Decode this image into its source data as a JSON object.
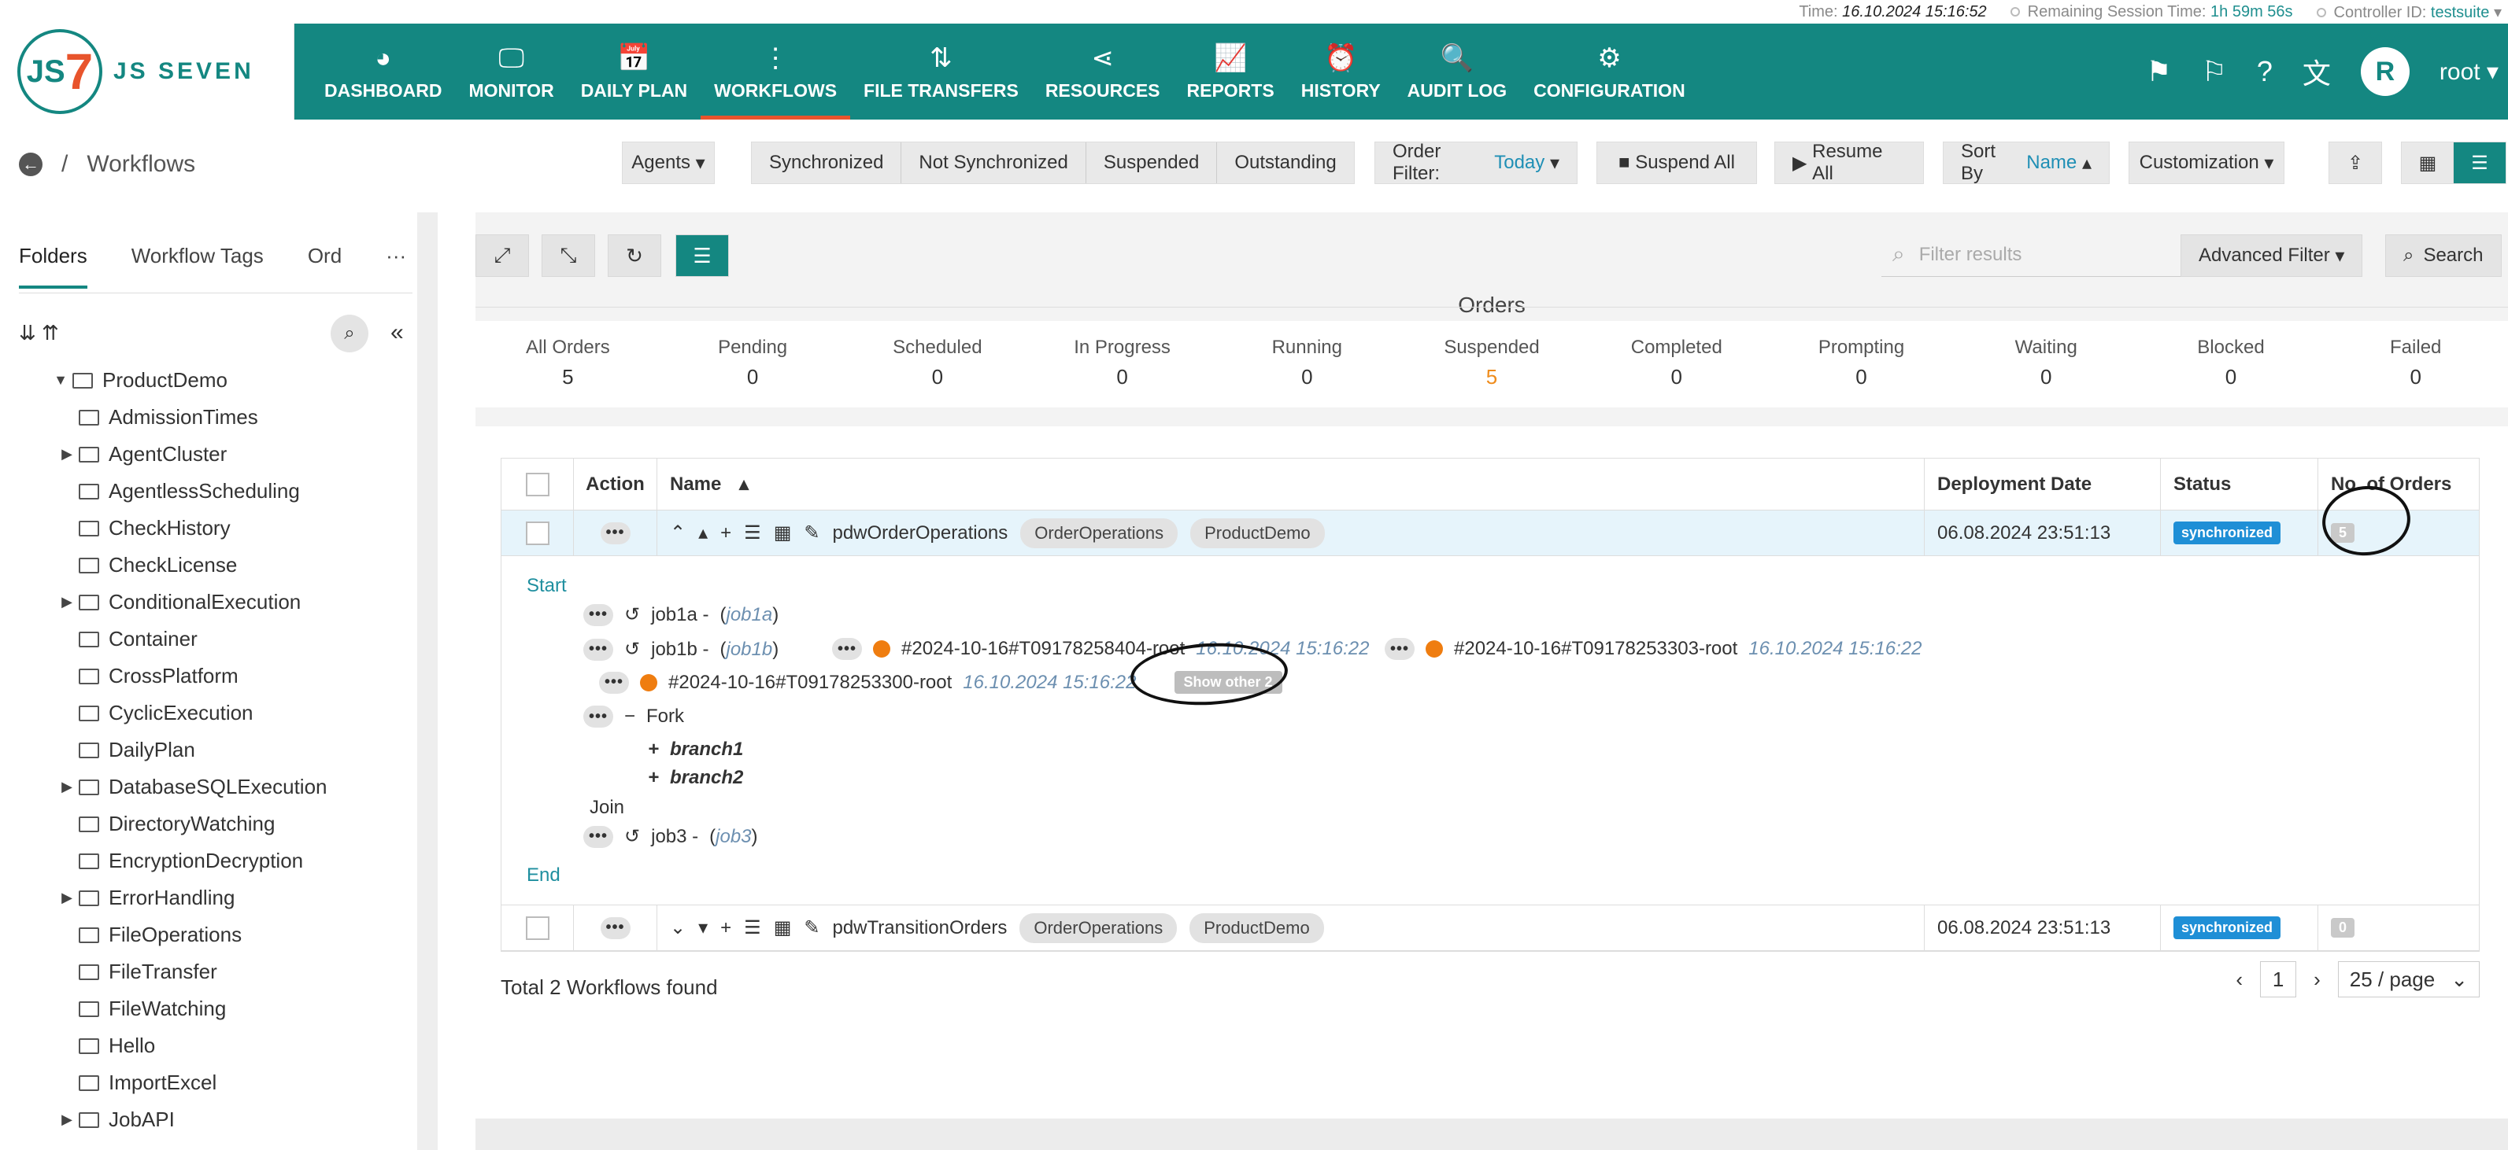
{
  "session": {
    "time_label": "Time:",
    "time_value": "16.10.2024 15:16:52",
    "remaining_label": "Remaining Session Time:",
    "remaining_value": "1h 59m 56s",
    "controller_label": "Controller ID:",
    "controller_value": "testsuite"
  },
  "brand": {
    "logo_mark": "JS7",
    "logo_text": "JS SEVEN"
  },
  "nav": [
    {
      "label": "DASHBOARD",
      "icon": "dashboard-icon",
      "glyph": "◕"
    },
    {
      "label": "MONITOR",
      "icon": "monitor-icon",
      "glyph": "🖵"
    },
    {
      "label": "DAILY PLAN",
      "icon": "calendar-icon",
      "glyph": "📅"
    },
    {
      "label": "WORKFLOWS",
      "icon": "workflow-icon",
      "glyph": "⋮",
      "active": true
    },
    {
      "label": "FILE TRANSFERS",
      "icon": "transfer-icon",
      "glyph": "⇅"
    },
    {
      "label": "RESOURCES",
      "icon": "share-icon",
      "glyph": "⋖"
    },
    {
      "label": "REPORTS",
      "icon": "chart-icon",
      "glyph": "📈"
    },
    {
      "label": "HISTORY",
      "icon": "clock-icon",
      "glyph": "⏰"
    },
    {
      "label": "AUDIT LOG",
      "icon": "audit-icon",
      "glyph": "🔍"
    },
    {
      "label": "CONFIGURATION",
      "icon": "gear-icon",
      "glyph": "⚙"
    }
  ],
  "user": {
    "avatar_letter": "R",
    "name": "root"
  },
  "breadcrumb": {
    "title": "Workflows"
  },
  "toolbar": {
    "agents": "Agents",
    "seg": [
      "Synchronized",
      "Not Synchronized",
      "Suspended",
      "Outstanding"
    ],
    "order_filter_label": "Order Filter:",
    "order_filter_value": "Today",
    "suspend_all": "Suspend All",
    "resume_all": "Resume All",
    "sort_label": "Sort By",
    "sort_value": "Name",
    "customization": "Customization"
  },
  "left": {
    "tabs": [
      "Folders",
      "Workflow Tags",
      "Ord"
    ],
    "more": "···",
    "root_folder": "ProductDemo",
    "folders": [
      {
        "name": "AdmissionTimes",
        "caret": false
      },
      {
        "name": "AgentCluster",
        "caret": true
      },
      {
        "name": "AgentlessScheduling",
        "caret": false
      },
      {
        "name": "CheckHistory",
        "caret": false
      },
      {
        "name": "CheckLicense",
        "caret": false
      },
      {
        "name": "ConditionalExecution",
        "caret": true
      },
      {
        "name": "Container",
        "caret": false
      },
      {
        "name": "CrossPlatform",
        "caret": false
      },
      {
        "name": "CyclicExecution",
        "caret": false
      },
      {
        "name": "DailyPlan",
        "caret": false
      },
      {
        "name": "DatabaseSQLExecution",
        "caret": true
      },
      {
        "name": "DirectoryWatching",
        "caret": false
      },
      {
        "name": "EncryptionDecryption",
        "caret": false
      },
      {
        "name": "ErrorHandling",
        "caret": true
      },
      {
        "name": "FileOperations",
        "caret": false
      },
      {
        "name": "FileTransfer",
        "caret": false
      },
      {
        "name": "FileWatching",
        "caret": false
      },
      {
        "name": "Hello",
        "caret": false
      },
      {
        "name": "ImportExcel",
        "caret": false
      },
      {
        "name": "JobAPI",
        "caret": true
      }
    ]
  },
  "main": {
    "filter_placeholder": "Filter results",
    "advanced_filter": "Advanced Filter",
    "search": "Search",
    "orders_title": "Orders",
    "stats": [
      {
        "label": "All Orders",
        "value": "5"
      },
      {
        "label": "Pending",
        "value": "0"
      },
      {
        "label": "Scheduled",
        "value": "0"
      },
      {
        "label": "In Progress",
        "value": "0"
      },
      {
        "label": "Running",
        "value": "0"
      },
      {
        "label": "Suspended",
        "value": "5",
        "orange": true
      },
      {
        "label": "Completed",
        "value": "0"
      },
      {
        "label": "Prompting",
        "value": "0"
      },
      {
        "label": "Waiting",
        "value": "0"
      },
      {
        "label": "Blocked",
        "value": "0"
      },
      {
        "label": "Failed",
        "value": "0"
      }
    ],
    "columns": {
      "action": "Action",
      "name": "Name",
      "date": "Deployment Date",
      "status": "Status",
      "orders": "No. of Orders"
    },
    "workflows": [
      {
        "name": "pdwOrderOperations",
        "tags": [
          "OrderOperations",
          "ProductDemo"
        ],
        "date": "06.08.2024 23:51:13",
        "status": "synchronized",
        "orders": "5"
      },
      {
        "name": "pdwTransitionOrders",
        "tags": [
          "OrderOperations",
          "ProductDemo"
        ],
        "date": "06.08.2024 23:51:13",
        "status": "synchronized",
        "orders": "0"
      }
    ],
    "expand": {
      "start": "Start",
      "end": "End",
      "job1a": "job1a -",
      "job1a_link": "job1a",
      "job1b": "job1b -",
      "job1b_link": "job1b",
      "order1": "#2024-10-16#T09178258404-root",
      "order1_time": "16.10.2024 15:16:22",
      "order2": "#2024-10-16#T09178253303-root",
      "order2_time": "16.10.2024 15:16:22",
      "order3": "#2024-10-16#T09178253300-root",
      "order3_time": "16.10.2024 15:16:22",
      "show_other": "Show other 2",
      "fork": "Fork",
      "branch1": "branch1",
      "branch2": "branch2",
      "join": "Join",
      "job3": "job3 -",
      "job3_link": "job3"
    },
    "total": "Total 2 Workflows found",
    "page": "1",
    "per_page": "25 / page"
  }
}
